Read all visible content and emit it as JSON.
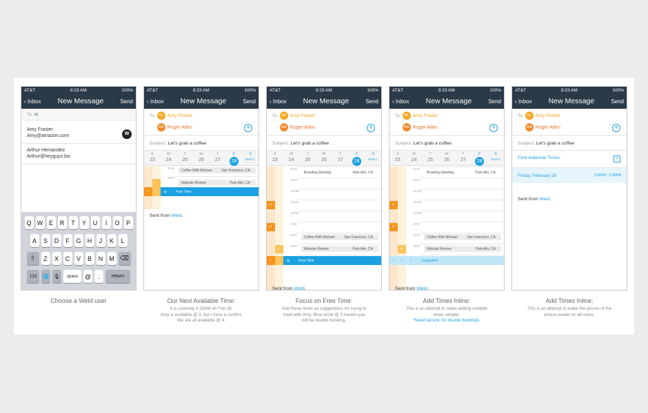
{
  "status": {
    "carrier": "AT&T",
    "time": "9:23 AM",
    "battery": "100%"
  },
  "nav": {
    "back": "Inbox",
    "title": "New Message",
    "send": "Send"
  },
  "compose": {
    "to_label": "To:",
    "to_query": "A",
    "contacts": [
      {
        "name": "Amy Frasier",
        "email": "Amy@amazon.com",
        "badge": "W"
      },
      {
        "name": "Arthur Hernandez",
        "email": "Arthur@heyguys.biz"
      }
    ],
    "recipients": [
      {
        "initials": "AF",
        "name": "Amy Fraser"
      },
      {
        "initials": "RA",
        "name": "Roger Allen"
      }
    ],
    "subject_label": "Subject:",
    "subject": "Let's grab a coffee",
    "sent_prefix": "Sent from",
    "sent_link": "Weld",
    "period": ".",
    "find_times": "Find Addional Times",
    "suggested_day": "Friday, February 28",
    "suggested_range": "5:00PM - 6:00PM"
  },
  "keyboard": {
    "row1": [
      "Q",
      "W",
      "E",
      "R",
      "T",
      "Y",
      "U",
      "I",
      "O",
      "P"
    ],
    "row2": [
      "A",
      "S",
      "D",
      "F",
      "G",
      "H",
      "J",
      "K",
      "L"
    ],
    "row3": [
      "Z",
      "X",
      "C",
      "V",
      "B",
      "N",
      "M"
    ],
    "num": "123",
    "space": "space",
    "at": "@",
    "dot": ".",
    "ret": "return",
    "shift": "⇧",
    "del": "⌫",
    "globe": "🌐",
    "mic": "🎙"
  },
  "week": [
    {
      "d": "S",
      "n": "23"
    },
    {
      "d": "M",
      "n": "24"
    },
    {
      "d": "T",
      "n": "25"
    },
    {
      "d": "W",
      "n": "26"
    },
    {
      "d": "T",
      "n": "27"
    },
    {
      "d": "F",
      "n": "28"
    },
    {
      "d": "S",
      "n": "MAR 1"
    }
  ],
  "events": {
    "coffee": {
      "title": "Coffee With Michael",
      "loc": "San Francisco, CA"
    },
    "website": {
      "title": "Website Review",
      "loc": "Palo Alto, CA"
    },
    "branding": {
      "title": "Branding Meeting",
      "loc": "Palo Alto, CA"
    },
    "free": "Free Time",
    "suggested": "Suggested"
  },
  "times": {
    "t2": "2PM",
    "t3": "3PM",
    "t4": "4PM",
    "t8": "8AM",
    "t9": "9AM",
    "t10": "10AM",
    "t11": "11AM",
    "t12": "12PM",
    "t1": "1PM"
  },
  "captions": [
    {
      "title": "Choose a Weld user",
      "body": [],
      "note": ""
    },
    {
      "title": "Our Next Available Time:",
      "body": [
        "It is currently 9:23AM on Feb 28.",
        "Amy is available @ 3, but I have a conflict.",
        "We are all available @ 4."
      ],
      "note": ""
    },
    {
      "title": "Focus on Free Time:",
      "body": [
        "Add these times as suggestions for trying to",
        "meet with Amy. Blue circle @ 3 means you",
        "will be double booking."
      ],
      "note": ""
    },
    {
      "title": "Add Times Inline:",
      "body": [
        "This is an attempt to make adding mulitple",
        "times simpler."
      ],
      "note": "*Need version for double bookings."
    },
    {
      "title": "Add Times Inline:",
      "body": [
        "This is an attempt to make the yes/no of the",
        "prcess easier on all users."
      ],
      "note": ""
    }
  ],
  "colors": {
    "navbar": "#2b3a48",
    "accent": "#1ba1e2",
    "orange": "#f7941d"
  }
}
